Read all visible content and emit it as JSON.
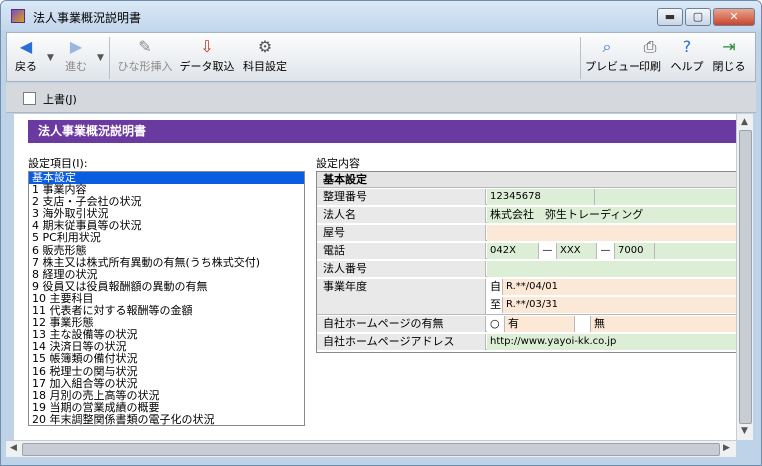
{
  "window": {
    "title": "法人事業概況説明書",
    "minimize": "▬",
    "maximize": "▢",
    "close": "✕"
  },
  "toolbar": {
    "back": "戻る",
    "forward": "進む",
    "template": "ひな形挿入",
    "import": "データ取込",
    "accounts": "科目設定",
    "preview": "プレビュー",
    "print": "印刷",
    "help": "ヘルプ",
    "close": "閉じる"
  },
  "overwrite_label": "上書(J)",
  "header_title": "法人事業概況説明書",
  "settings_items_label": "設定項目(I):",
  "settings_content_label": "設定内容",
  "list_items": [
    "基本設定",
    "1 事業内容",
    "2 支店・子会社の状況",
    "3 海外取引状況",
    "4 期末従事員等の状況",
    "5 PC利用状況",
    "6 販売形態",
    "7 株主又は株式所有異動の有無(うち株式交付)",
    "8 経理の状況",
    "9 役員又は役員報酬額の異動の有無",
    "10 主要科目",
    "11 代表者に対する報酬等の金額",
    "12 事業形態",
    "13 主な設備等の状況",
    "14 決済日等の状況",
    "15 帳簿類の備付状況",
    "16 税理士の関与状況",
    "17 加入組合等の状況",
    "18 月別の売上高等の状況",
    "19 当期の営業成績の概要",
    "20 年末調整関係書類の電子化の状況"
  ],
  "form": {
    "section": "基本設定",
    "reg_no_label": "整理番号",
    "reg_no": "12345678",
    "corp_name_label": "法人名",
    "corp_name": "株式会社　弥生トレーディング",
    "trade_name_label": "屋号",
    "trade_name": "",
    "phone_label": "電話",
    "phone1": "042X",
    "phone2": "XXX",
    "phone3": "7000",
    "dash": "—",
    "corp_number_label": "法人番号",
    "corp_number": "",
    "fiscal_year_label": "事業年度",
    "from": "自",
    "from_date": "R.**/04/01",
    "to": "至",
    "to_date": "R.**/03/31",
    "homepage_label": "自社ホームページの有無",
    "hp_yes_mark": "○",
    "hp_yes": "有",
    "hp_no": "無",
    "homepage_url_label": "自社ホームページアドレス",
    "homepage_url": "http://www.yayoi-kk.co.jp"
  }
}
